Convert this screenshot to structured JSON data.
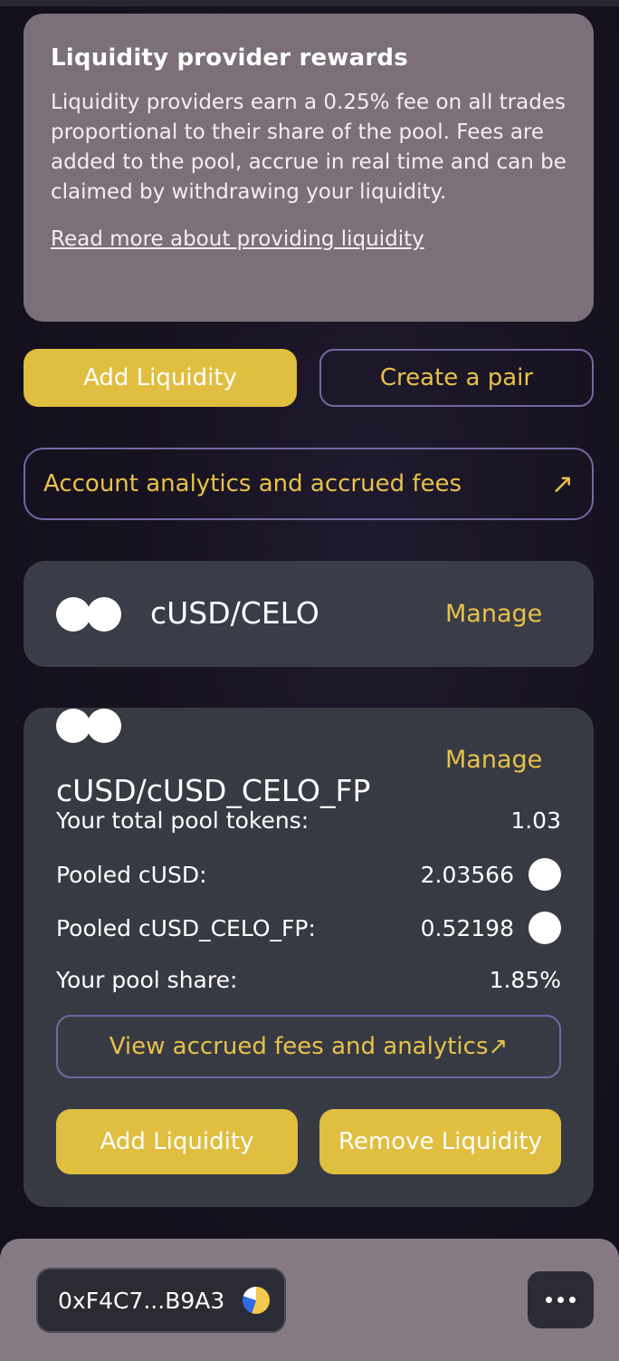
{
  "info": {
    "title": "Liquidity provider rewards",
    "body": "Liquidity providers earn a 0.25% fee on all trades proportional to their share of the pool. Fees are added to the pool, accrue in real time and can be claimed by withdrawing your liquidity.",
    "link": "Read more about providing liquidity"
  },
  "actions": {
    "add_liquidity": "Add Liquidity",
    "create_pair": "Create a pair"
  },
  "analytics": {
    "label": "Account analytics and accrued fees",
    "arrow": "↗"
  },
  "pools": [
    {
      "name": "cUSD/CELO",
      "manage": "Manage"
    },
    {
      "name": "cUSD/cUSD_CELO_FP",
      "manage": "Manage",
      "rows": [
        {
          "label": "Your total pool tokens:",
          "value": "1.03"
        },
        {
          "label": "Pooled cUSD:",
          "value": "2.03566"
        },
        {
          "label": "Pooled cUSD_CELO_FP:",
          "value": "0.52198"
        },
        {
          "label": "Your pool share:",
          "value": "1.85%"
        }
      ],
      "view_fees": "View accrued fees and analytics↗",
      "add": "Add Liquidity",
      "remove": "Remove Liquidity"
    }
  ],
  "footer": {
    "wallet_address": "0xF4C7...B9A3",
    "wallet_icon": "celo-logo-icon",
    "more_icon": "more-dots-icon"
  },
  "colors": {
    "accent": "#e0be40",
    "accent_text": "#e8c14a",
    "outline": "#7467a6",
    "info_card": "#7b7079",
    "pool_card": "#3a3d47"
  }
}
